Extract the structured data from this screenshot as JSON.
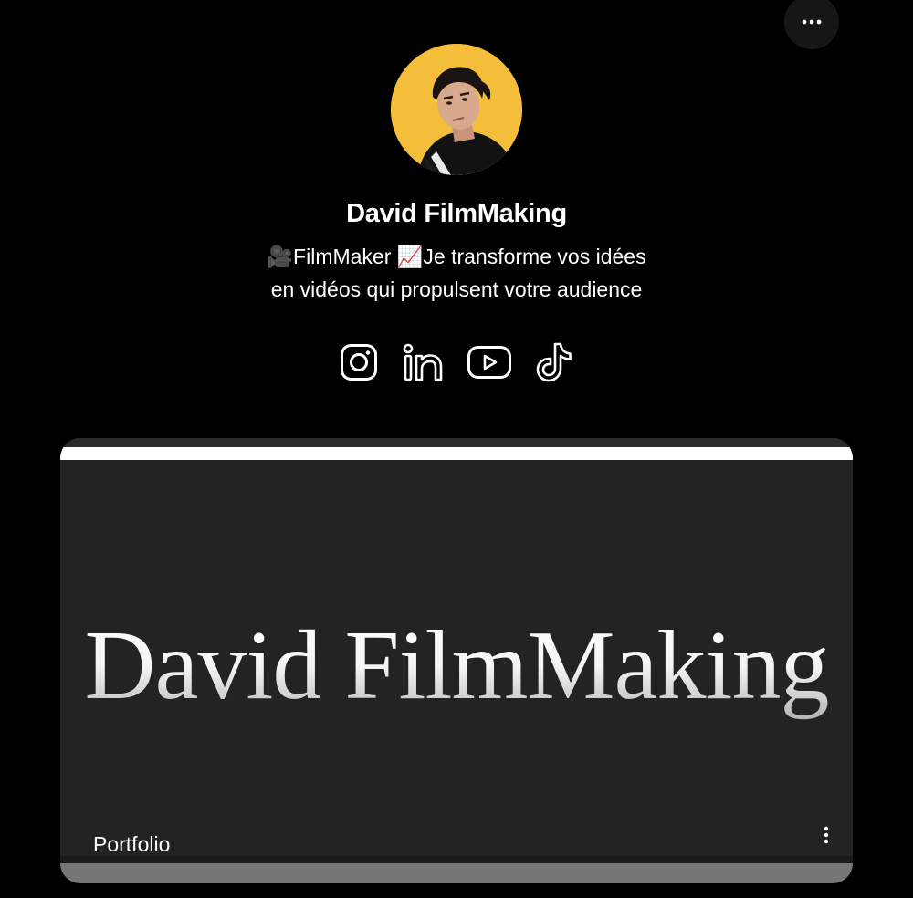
{
  "header": {
    "more_icon": "more-horizontal-icon"
  },
  "profile": {
    "name": "David FilmMaking",
    "bio_line1": "🎥FilmMaker 📈Je transforme vos idées",
    "bio_line2": "en vidéos qui propulsent votre audience",
    "avatar_bg": "#f5be3a"
  },
  "socials": [
    {
      "icon": "instagram-icon"
    },
    {
      "icon": "linkedin-icon"
    },
    {
      "icon": "youtube-icon"
    },
    {
      "icon": "tiktok-icon"
    }
  ],
  "link_card": {
    "thumbnail_text": "David FilmMaking",
    "label": "Portfolio",
    "menu_icon": "more-vertical-icon"
  }
}
